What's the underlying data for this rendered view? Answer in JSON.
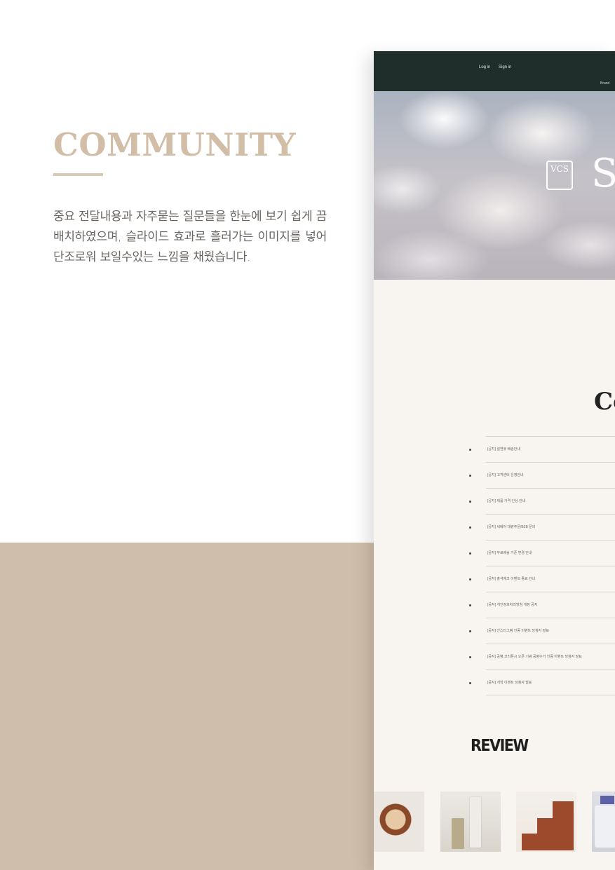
{
  "intro": {
    "title": "COMMUNITY",
    "description": "중요 전달내용과 자주묻는 질문들을 한눈에 보기 쉽게 끔 배치하였으며, 슬라이드 효과로 흘러가는 이미지를 넣어 단조로워 보일수있는 느낌을 채웠습니다."
  },
  "mock": {
    "nav": {
      "login": "Log in",
      "signin": "Sign in",
      "brand": "Brand"
    },
    "hero": {
      "logo_text": "VCS",
      "wordmark": "S"
    },
    "community_heading": "Co",
    "notices": [
      "[공지] 설연휴 배송안내",
      "[공지] 고객센터 운영안내",
      "[공지] 제품 가격 인상 안내",
      "[공지] 세베어 대량주문/B2B 문의",
      "[공지] 무료배송 기준 변경 안내",
      "[공지] 출석체크 이벤트 종료 안내",
      "[공지] 개인정보처리방침 개정 공지",
      "[공지] 인스타그램 인증 이벤트 당첨자 발표",
      "[공지] 공병 코리톤시 오픈 기념 공병수거 인증 이벤트 당첨자 발표",
      "[공지] 개학 이벤트 당첨자 발표"
    ],
    "review_heading": "REVIEW"
  },
  "colors": {
    "accent_title": "#d2bea7",
    "band": "#cfbeab",
    "nav": "#1f2e2a",
    "mock_bg": "#f8f5f1"
  }
}
